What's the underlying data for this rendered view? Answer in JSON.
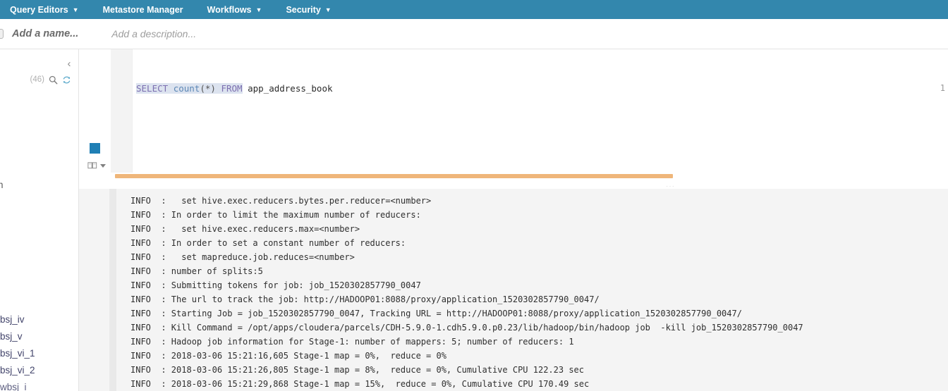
{
  "navbar": {
    "items": [
      {
        "label": "Query Editors",
        "has_caret": true
      },
      {
        "label": "Metastore Manager",
        "has_caret": false
      },
      {
        "label": "Workflows",
        "has_caret": true
      },
      {
        "label": "Security",
        "has_caret": true
      }
    ],
    "background_color": "#3387ad",
    "text_color": "#ffffff"
  },
  "titlebar": {
    "name_placeholder": "Add a name...",
    "description_placeholder": "Add a description..."
  },
  "assist": {
    "collapse_icon": "chevron-left-icon",
    "count_label": "(46)",
    "search_icon": "search-icon",
    "refresh_icon": "refresh-icon",
    "partial_label": "n",
    "entries": [
      {
        "label": "bsj_iv"
      },
      {
        "label": "bsj_v"
      },
      {
        "label": "bsj_vi_1"
      },
      {
        "label": "bsj_vi_2"
      },
      {
        "label": "wbsj_i"
      }
    ]
  },
  "editor_toolbar": {
    "stop_icon": "stop-square-icon",
    "stop_color": "#1f7fb5",
    "history_icon": "book-history-icon",
    "history_caret_icon": "chevron-down-icon"
  },
  "editor": {
    "line_number": "1",
    "query_tokens": {
      "select": "SELECT",
      "count_fn": "count",
      "open_paren": "(",
      "star": "*",
      "close_paren": ")",
      "from": "FROM",
      "table": "app_address_book"
    },
    "query_text": "SELECT count(*) FROM app_address_book"
  },
  "progress": {
    "percent": 67,
    "color": "#efb67a",
    "resize_grip": "···"
  },
  "log": {
    "lines": [
      "INFO  :   set hive.exec.reducers.bytes.per.reducer=<number>",
      "INFO  : In order to limit the maximum number of reducers:",
      "INFO  :   set hive.exec.reducers.max=<number>",
      "INFO  : In order to set a constant number of reducers:",
      "INFO  :   set mapreduce.job.reduces=<number>",
      "INFO  : number of splits:5",
      "INFO  : Submitting tokens for job: job_1520302857790_0047",
      "INFO  : The url to track the job: http://HADOOP01:8088/proxy/application_1520302857790_0047/",
      "INFO  : Starting Job = job_1520302857790_0047, Tracking URL = http://HADOOP01:8088/proxy/application_1520302857790_0047/",
      "INFO  : Kill Command = /opt/apps/cloudera/parcels/CDH-5.9.0-1.cdh5.9.0.p0.23/lib/hadoop/bin/hadoop job  -kill job_1520302857790_0047",
      "INFO  : Hadoop job information for Stage-1: number of mappers: 5; number of reducers: 1",
      "INFO  : 2018-03-06 15:21:16,605 Stage-1 map = 0%,  reduce = 0%",
      "INFO  : 2018-03-06 15:21:26,805 Stage-1 map = 8%,  reduce = 0%, Cumulative CPU 122.23 sec",
      "INFO  : 2018-03-06 15:21:29,868 Stage-1 map = 15%,  reduce = 0%, Cumulative CPU 170.49 sec"
    ]
  }
}
